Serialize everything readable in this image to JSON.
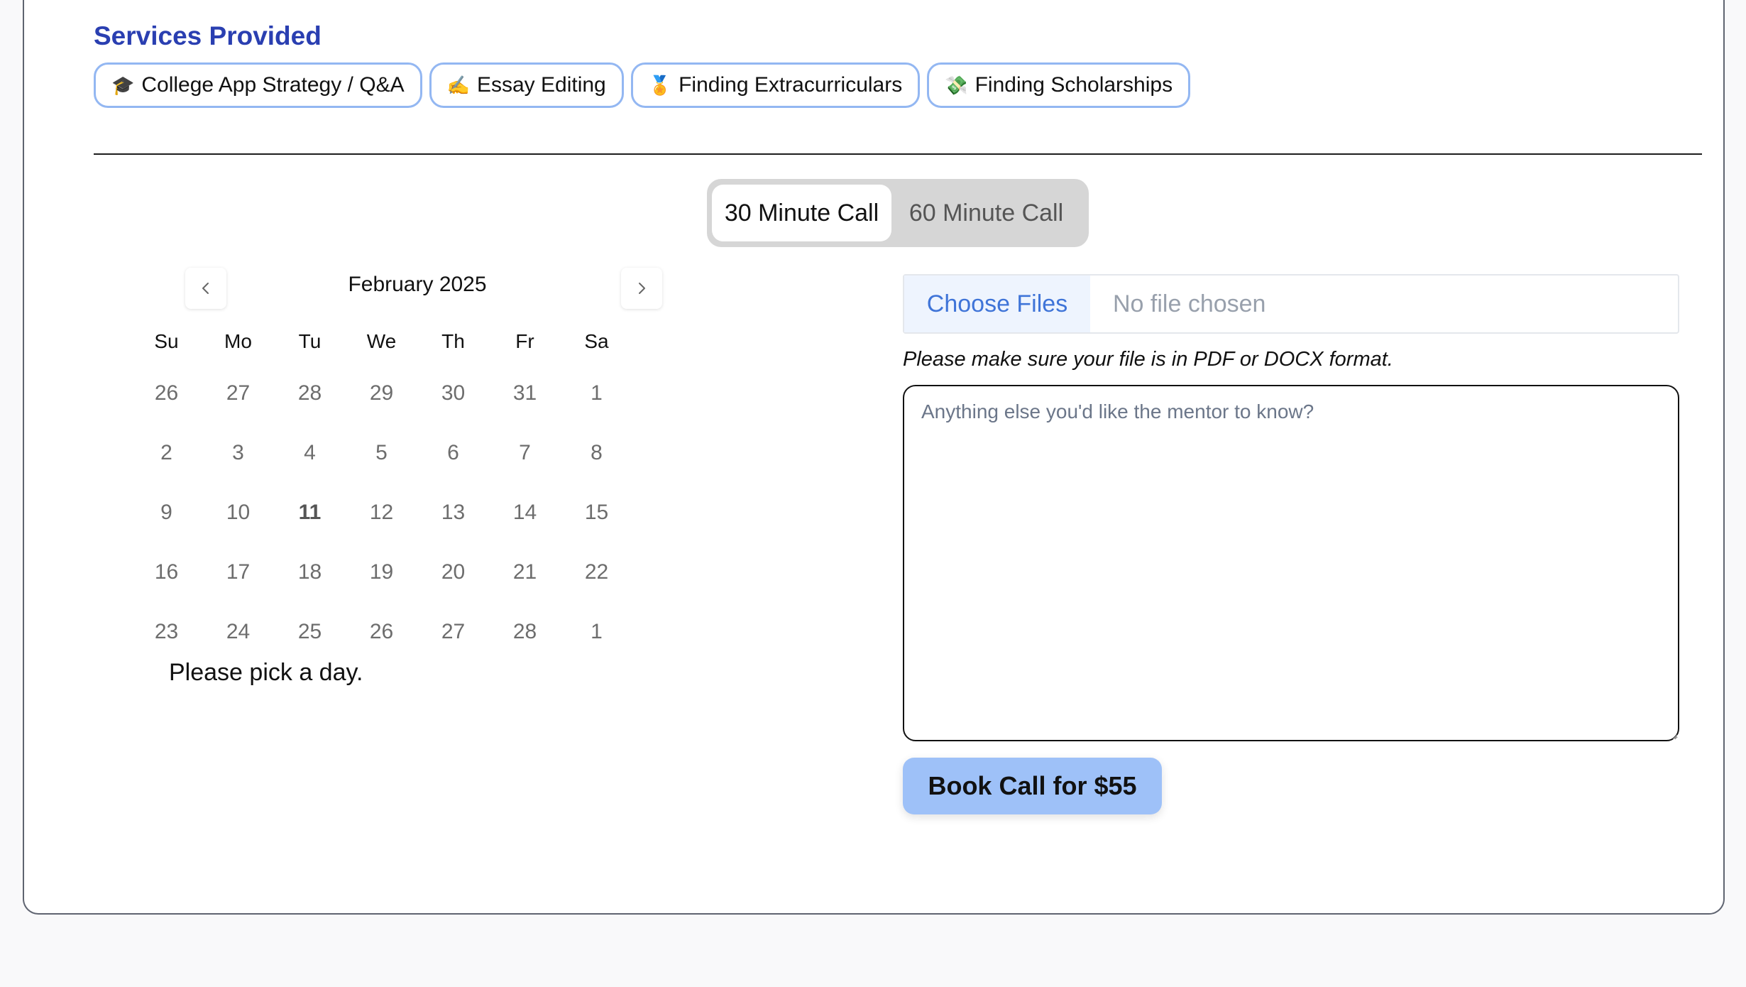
{
  "services": {
    "title": "Services Provided",
    "items": [
      {
        "icon": "🎓",
        "icon_name": "graduation-cap-icon",
        "label": "College App Strategy / Q&A"
      },
      {
        "icon": "✍️",
        "icon_name": "writing-hand-icon",
        "label": "Essay Editing"
      },
      {
        "icon": "🏅",
        "icon_name": "medal-icon",
        "label": "Finding Extracurriculars"
      },
      {
        "icon": "💸",
        "icon_name": "money-wings-icon",
        "label": "Finding Scholarships"
      }
    ]
  },
  "call_toggle": {
    "options": [
      "30 Minute Call",
      "60 Minute Call"
    ],
    "selected": "30 Minute Call"
  },
  "calendar": {
    "month_label": "February 2025",
    "prev_icon": "chevron-left-icon",
    "next_icon": "chevron-right-icon",
    "weekdays": [
      "Su",
      "Mo",
      "Tu",
      "We",
      "Th",
      "Fr",
      "Sa"
    ],
    "weeks": [
      [
        "26",
        "27",
        "28",
        "29",
        "30",
        "31",
        "1"
      ],
      [
        "2",
        "3",
        "4",
        "5",
        "6",
        "7",
        "8"
      ],
      [
        "9",
        "10",
        "11",
        "12",
        "13",
        "14",
        "15"
      ],
      [
        "16",
        "17",
        "18",
        "19",
        "20",
        "21",
        "22"
      ],
      [
        "23",
        "24",
        "25",
        "26",
        "27",
        "28",
        "1"
      ]
    ],
    "today": "11",
    "helper_text": "Please pick a day."
  },
  "file_upload": {
    "button_label": "Choose Files",
    "status": "No file chosen",
    "note": "Please make sure your file is in PDF or DOCX format."
  },
  "notes": {
    "placeholder": "Anything else you'd like the mentor to know?",
    "value": ""
  },
  "book_button": {
    "label": "Book Call for $55"
  },
  "colors": {
    "title": "#2a3fb1",
    "chip_border": "#93b7f2",
    "file_button_bg": "#eef4fe",
    "file_button_text": "#3f74d8",
    "book_button_bg": "#9ec1f8"
  }
}
